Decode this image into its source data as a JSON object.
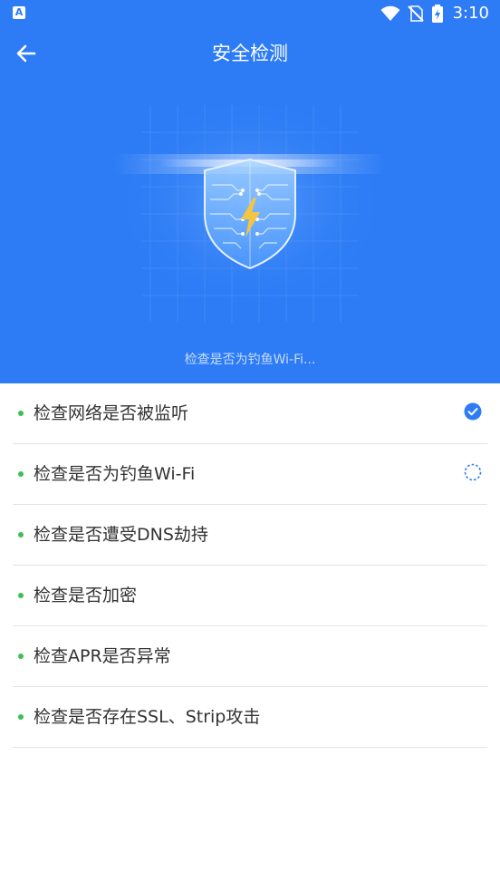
{
  "statusbar": {
    "app_icon": "A",
    "time": "3:10",
    "icons": [
      "wifi-icon",
      "no-sim-icon",
      "battery-charging-icon"
    ]
  },
  "appbar": {
    "back_icon": "arrow-left-icon",
    "title": "安全检测"
  },
  "hero": {
    "illustration": "shield-lightning-icon",
    "scan_status": "检查是否为钓鱼Wi-Fi..."
  },
  "checks": [
    {
      "label": "检查网络是否被监听",
      "state": "done"
    },
    {
      "label": "检查是否为钓鱼Wi-Fi",
      "state": "loading"
    },
    {
      "label": "检查是否遭受DNS劫持",
      "state": "pending"
    },
    {
      "label": "检查是否加密",
      "state": "pending"
    },
    {
      "label": "检查APR是否异常",
      "state": "pending"
    },
    {
      "label": "检查是否存在SSL、Strip攻击",
      "state": "pending"
    }
  ],
  "colors": {
    "header_bg": "#2d7cf6",
    "accent": "#2d7cf6",
    "bullet": "#3cbf57",
    "lightning": "#f5c542"
  }
}
